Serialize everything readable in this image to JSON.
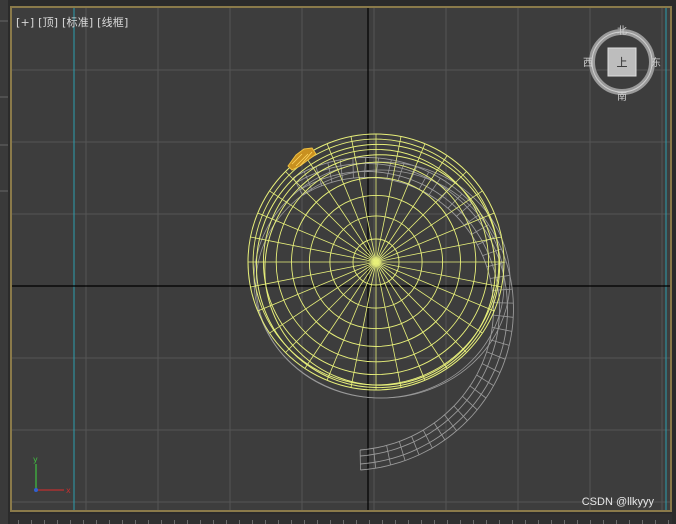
{
  "viewport": {
    "label_parts": [
      "[+]",
      "[顶]",
      "[标准]",
      "[线框]"
    ]
  },
  "viewcube": {
    "north": "北",
    "south": "南",
    "west": "西",
    "east": "东",
    "face": "上"
  },
  "watermark": "CSDN @llkyyy",
  "colors": {
    "background": "#3d3d3d",
    "grid": "#555555",
    "axis": "#000000",
    "selected_wire": "#e8f07a",
    "unselected_wire": "#9a9a9a",
    "highlight": "#e0a020",
    "frame": "#8a7a4a",
    "cyan_guide": "#2aa0b0"
  },
  "icons": [
    "viewport-menu-plus-icon",
    "viewcube-icon",
    "axis-tripod-icon"
  ]
}
